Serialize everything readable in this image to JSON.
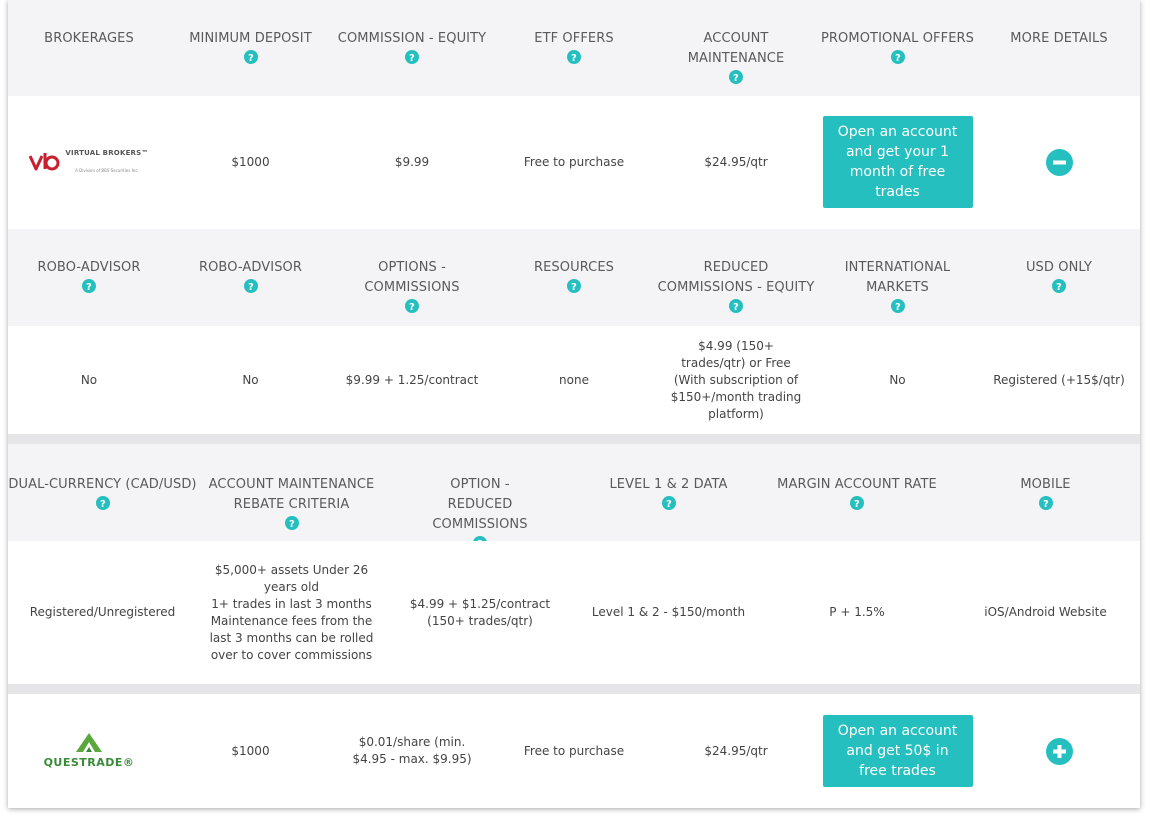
{
  "colors": {
    "accent": "#26bfbf",
    "header_bg": "#f4f3f5",
    "separator": "#e6e6e8"
  },
  "section1": {
    "headers": [
      "BROKERAGES",
      "MINIMUM DEPOSIT",
      "COMMISSION - EQUITY",
      "ETF OFFERS",
      "ACCOUNT MAINTENANCE",
      "PROMOTIONAL OFFERS",
      "MORE DETAILS"
    ]
  },
  "broker1": {
    "logo_name": "VIRTUAL BROKERS™",
    "logo_sub": "A Division of BBS Securities Inc.",
    "min_deposit": "$1000",
    "commission_equity": "$9.99",
    "etf_offers": "Free to purchase",
    "account_maintenance": "$24.95/qtr",
    "promo_button": "Open an account and get your 1 month of free trades",
    "toggle_icon": "minus-circle-icon"
  },
  "section2": {
    "headers": [
      "ROBO-ADVISOR",
      "ROBO-ADVISOR",
      "OPTIONS - COMMISSIONS",
      "RESOURCES",
      "REDUCED COMMISSIONS - EQUITY",
      "INTERNATIONAL MARKETS",
      "USD ONLY"
    ],
    "values": [
      "No",
      "No",
      "$9.99 + 1.25/contract",
      "none",
      "$4.99 (150+ trades/qtr) or Free (With subscription of $150+/month trading platform)",
      "No",
      "Registered (+15$/qtr)"
    ]
  },
  "section3": {
    "headers": [
      "DUAL-CURRENCY (CAD/USD)",
      "ACCOUNT MAINTENANCE REBATE CRITERIA",
      "OPTION - REDUCED COMMISSIONS",
      "LEVEL 1 & 2 DATA",
      "MARGIN ACCOUNT RATE",
      "MOBILE"
    ],
    "values": [
      "Registered/Unregistered",
      "$5,000+ assets Under 26 years old\n1+ trades in last 3 months\nMaintenance fees from the last 3 months can be rolled over to cover commissions",
      "$4.99 + $1.25/contract (150+ trades/qtr)",
      "Level 1 & 2 - $150/month",
      "P + 1.5%",
      "iOS/Android Website"
    ]
  },
  "broker2": {
    "logo_name": "QUESTRADE®",
    "min_deposit": "$1000",
    "commission_equity": "$0.01/share (min. $4.95 - max. $9.95)",
    "etf_offers": "Free to purchase",
    "account_maintenance": "$24.95/qtr",
    "promo_button": "Open an account and get 50$ in free trades",
    "toggle_icon": "plus-circle-icon"
  }
}
